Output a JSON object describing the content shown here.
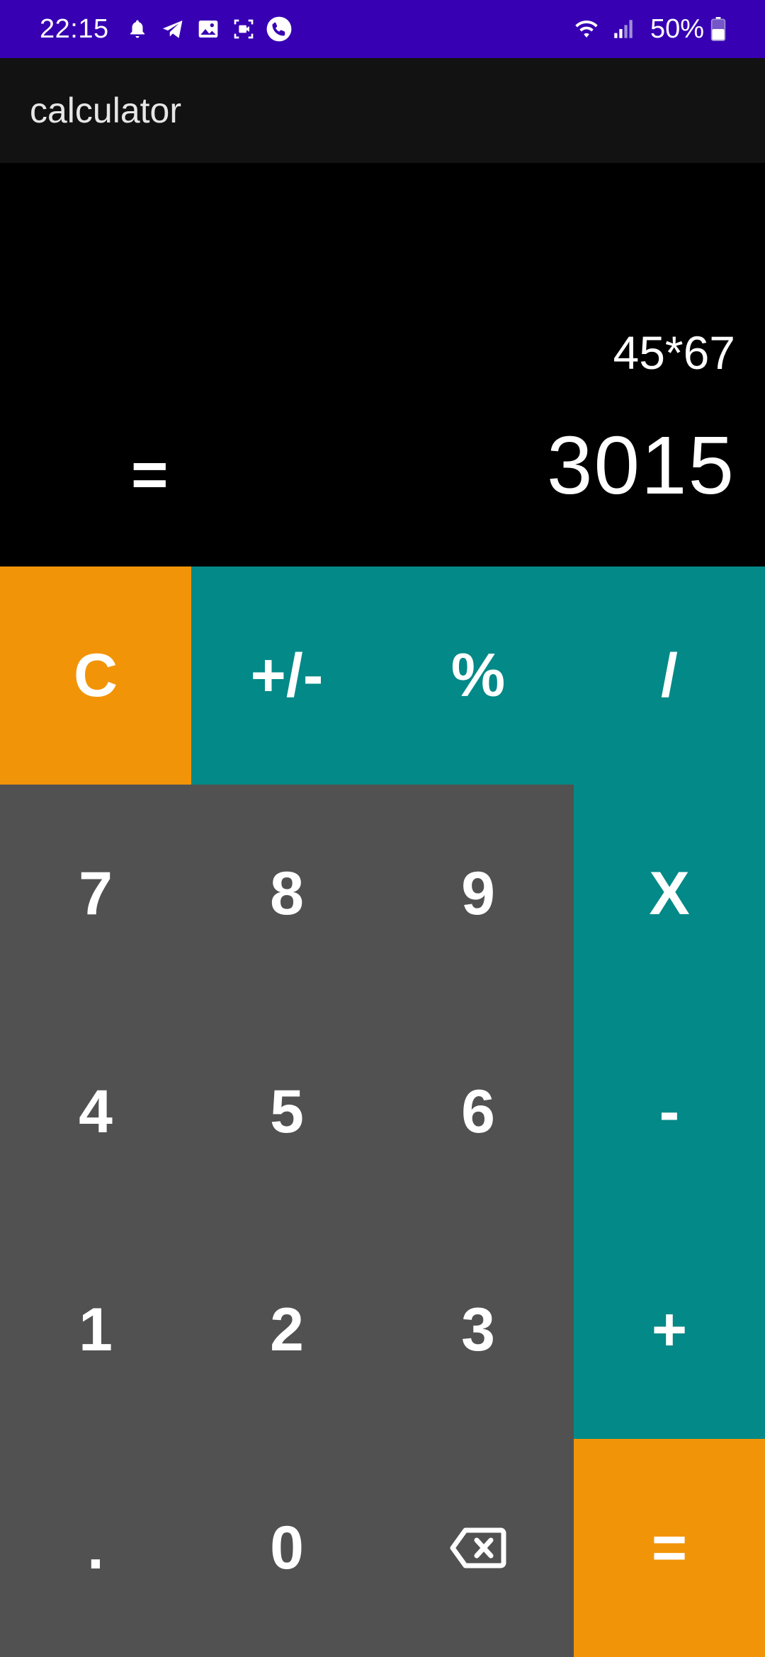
{
  "status_bar": {
    "time": "22:15",
    "battery": "50%",
    "left_icons": [
      "notification-bell-icon",
      "telegram-icon",
      "gallery-icon",
      "screen-record-icon",
      "phone-call-icon"
    ],
    "right_icons": [
      "wifi-icon",
      "signal-icon",
      "battery-icon"
    ],
    "background": "#3700b3"
  },
  "app_bar": {
    "title": "calculator"
  },
  "display": {
    "expression": "45*67",
    "equals_sign": "=",
    "result": "3015"
  },
  "keypad": {
    "rows": [
      [
        {
          "label": "C",
          "color": "orange"
        },
        {
          "label": "+/-",
          "color": "teal"
        },
        {
          "label": "%",
          "color": "teal"
        },
        {
          "label": "/",
          "color": "teal"
        }
      ],
      [
        {
          "label": "7",
          "color": "gray"
        },
        {
          "label": "8",
          "color": "gray"
        },
        {
          "label": "9",
          "color": "gray"
        },
        {
          "label": "X",
          "color": "teal"
        }
      ],
      [
        {
          "label": "4",
          "color": "gray"
        },
        {
          "label": "5",
          "color": "gray"
        },
        {
          "label": "6",
          "color": "gray"
        },
        {
          "label": "-",
          "color": "teal"
        }
      ],
      [
        {
          "label": "1",
          "color": "gray"
        },
        {
          "label": "2",
          "color": "gray"
        },
        {
          "label": "3",
          "color": "gray"
        },
        {
          "label": "+",
          "color": "teal"
        }
      ],
      [
        {
          "label": ".",
          "color": "gray"
        },
        {
          "label": "0",
          "color": "gray"
        },
        {
          "label": "",
          "icon": "backspace-icon",
          "color": "gray"
        },
        {
          "label": "=",
          "color": "orange"
        }
      ]
    ]
  },
  "colors": {
    "orange": "#f29408",
    "teal": "#038987",
    "gray": "#515151",
    "display_bg": "#000000",
    "app_bar_bg": "#121212"
  }
}
